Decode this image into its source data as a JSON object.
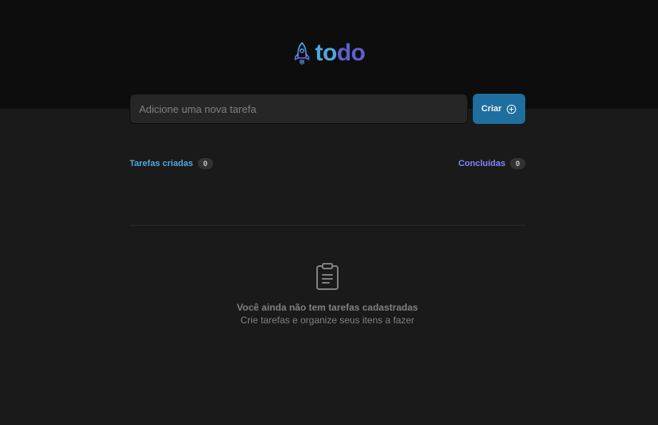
{
  "header": {
    "logo_icon": "rocket-icon",
    "logo_part_1": "to",
    "logo_part_2": "do",
    "colors": {
      "to": "#4ea8de",
      "do": "#5e60ce"
    }
  },
  "form": {
    "input_placeholder": "Adicione uma nova tarefa",
    "input_value": "",
    "create_label": "Criar",
    "create_icon": "plus-circle-icon"
  },
  "counters": {
    "created_label": "Tarefas criadas",
    "created_count": "0",
    "done_label": "Concluídas",
    "done_count": "0"
  },
  "empty_state": {
    "icon": "clipboard-icon",
    "title": "Você ainda não tem tarefas cadastradas",
    "subtitle": "Crie tarefas e organize seus itens a fazer"
  },
  "colors": {
    "background": "#1a1a1a",
    "header_background": "#0d0d0d",
    "blue": "#4ea8de",
    "purple": "#8284fa",
    "button": "#1e6f9f"
  }
}
